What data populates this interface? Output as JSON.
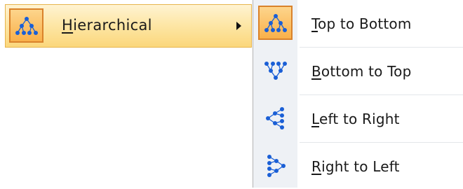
{
  "menu": {
    "parent": {
      "label_first": "H",
      "label_rest": "ierarchical",
      "icon": "hierarchy-icon"
    },
    "submenu": {
      "items": [
        {
          "first": "T",
          "rest": "op to Bottom",
          "icon": "tree-down-icon",
          "highlighted": true
        },
        {
          "first": "B",
          "rest": "ottom to Top",
          "icon": "tree-up-icon",
          "highlighted": false
        },
        {
          "first": "L",
          "rest": "eft to Right",
          "icon": "tree-right-icon",
          "highlighted": false
        },
        {
          "first": "R",
          "rest": "ight to Left",
          "icon": "tree-left-icon",
          "highlighted": false
        }
      ]
    }
  },
  "colors": {
    "highlight_border": "#d9822b",
    "highlight_fill": "#f9b04a",
    "icon_blue": "#1a5fd6",
    "icon_strip": "#eef1f5"
  }
}
